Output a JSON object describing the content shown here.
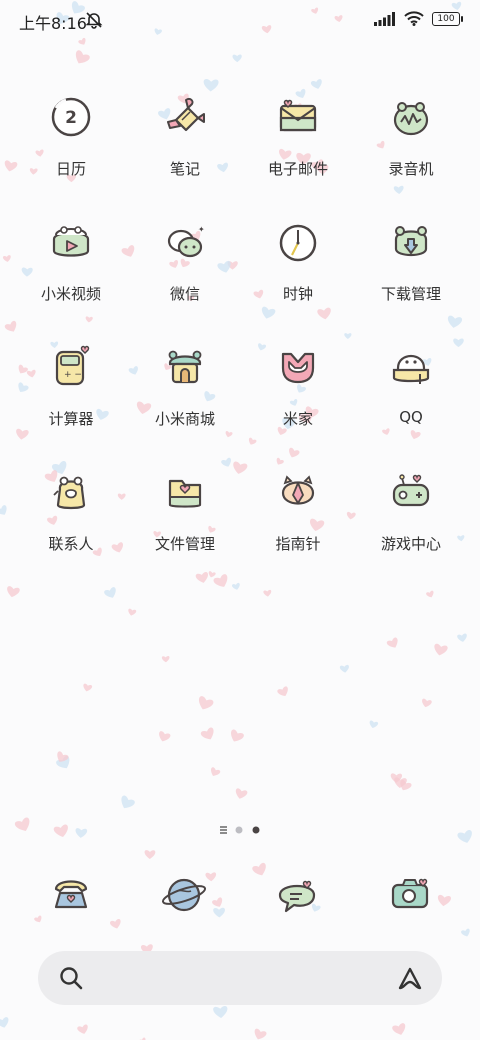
{
  "status_bar": {
    "time": "上午8:16",
    "battery": "100",
    "icons": [
      "dnd-bell-off-icon",
      "signal-icon",
      "wifi-icon",
      "battery-icon"
    ]
  },
  "apps": [
    {
      "label": "日历",
      "icon": "calendar-icon",
      "badge_text": "2"
    },
    {
      "label": "笔记",
      "icon": "notes-candy-icon"
    },
    {
      "label": "电子邮件",
      "icon": "email-envelope-icon"
    },
    {
      "label": "录音机",
      "icon": "recorder-frog-icon"
    },
    {
      "label": "小米视频",
      "icon": "video-play-icon"
    },
    {
      "label": "微信",
      "icon": "wechat-icon"
    },
    {
      "label": "时钟",
      "icon": "clock-icon"
    },
    {
      "label": "下载管理",
      "icon": "download-icon"
    },
    {
      "label": "计算器",
      "icon": "calculator-icon"
    },
    {
      "label": "小米商城",
      "icon": "store-house-icon"
    },
    {
      "label": "米家",
      "icon": "mijia-icon"
    },
    {
      "label": "QQ",
      "icon": "qq-penguin-icon"
    },
    {
      "label": "联系人",
      "icon": "contacts-frog-icon"
    },
    {
      "label": "文件管理",
      "icon": "file-manager-icon"
    },
    {
      "label": "指南针",
      "icon": "compass-icon"
    },
    {
      "label": "游戏中心",
      "icon": "game-controller-icon"
    }
  ],
  "page_indicator": {
    "pages": 3,
    "current": 3
  },
  "dock": [
    "phone-icon",
    "browser-planet-icon",
    "messages-bubble-icon",
    "camera-icon"
  ],
  "search_bar": {
    "left_icon": "search-icon",
    "right_icon": "assistant-icon"
  },
  "colors": {
    "background": "#fbfbfc",
    "heart_pink": "#f6c9d0",
    "heart_blue": "#cfe3f3",
    "icon_outline": "#4a4444",
    "icon_green": "#cfe6c8",
    "icon_yellow": "#f6e7a8",
    "icon_pink": "#f3a8b6",
    "icon_blue": "#a9c6df",
    "search_bg": "#ececee"
  }
}
